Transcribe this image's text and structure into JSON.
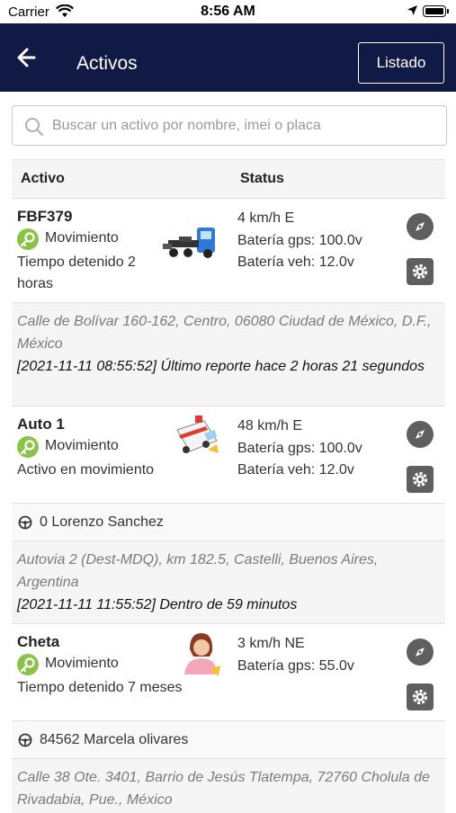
{
  "status_bar": {
    "carrier": "Carrier",
    "time": "8:56 AM"
  },
  "header": {
    "title": "Activos",
    "listado_label": "Listado",
    "colors": {
      "bg": "#101a45"
    }
  },
  "search": {
    "placeholder": "Buscar un activo por nombre, imei o placa"
  },
  "table": {
    "col_asset": "Activo",
    "col_status": "Status",
    "rows": [
      {
        "name": "FBF379",
        "state": "Movimiento",
        "sub": "Tiempo detenido 2 horas",
        "icon": "tow-truck-icon",
        "status": [
          "4 km/h E",
          "Batería gps: 100.0v",
          "Batería veh: 12.0v"
        ],
        "driver": "",
        "address": "Calle de Bolívar 160-162, Centro, 06080 Ciudad de México, D.F., México",
        "report": "[2021-11-11 08:55:52] Último reporte hace 2 horas 21 segundos"
      },
      {
        "name": "Auto 1",
        "state": "Movimiento",
        "sub": "Activo en movimiento",
        "icon": "ambulance-icon",
        "status": [
          "48 km/h E",
          "Batería gps: 100.0v",
          "Batería veh: 12.0v"
        ],
        "driver": "0 Lorenzo Sanchez",
        "address": "Autovia 2 (Dest-MDQ), km 182.5, Castelli, Buenos Aires, Argentina",
        "report": "[2021-11-11 11:55:52] Dentro de 59 minutos"
      },
      {
        "name": "Cheta",
        "state": "Movimiento",
        "sub": "Tiempo detenido 7 meses",
        "icon": "person-icon",
        "status": [
          "3 km/h NE",
          "Batería gps: 55.0v"
        ],
        "driver": "84562 Marcela olivares",
        "address": "Calle 38 Ote. 3401, Barrio de Jesús Tlatempa, 72760 Cholula de Rivadabia, Pue., México",
        "report": ""
      }
    ]
  }
}
